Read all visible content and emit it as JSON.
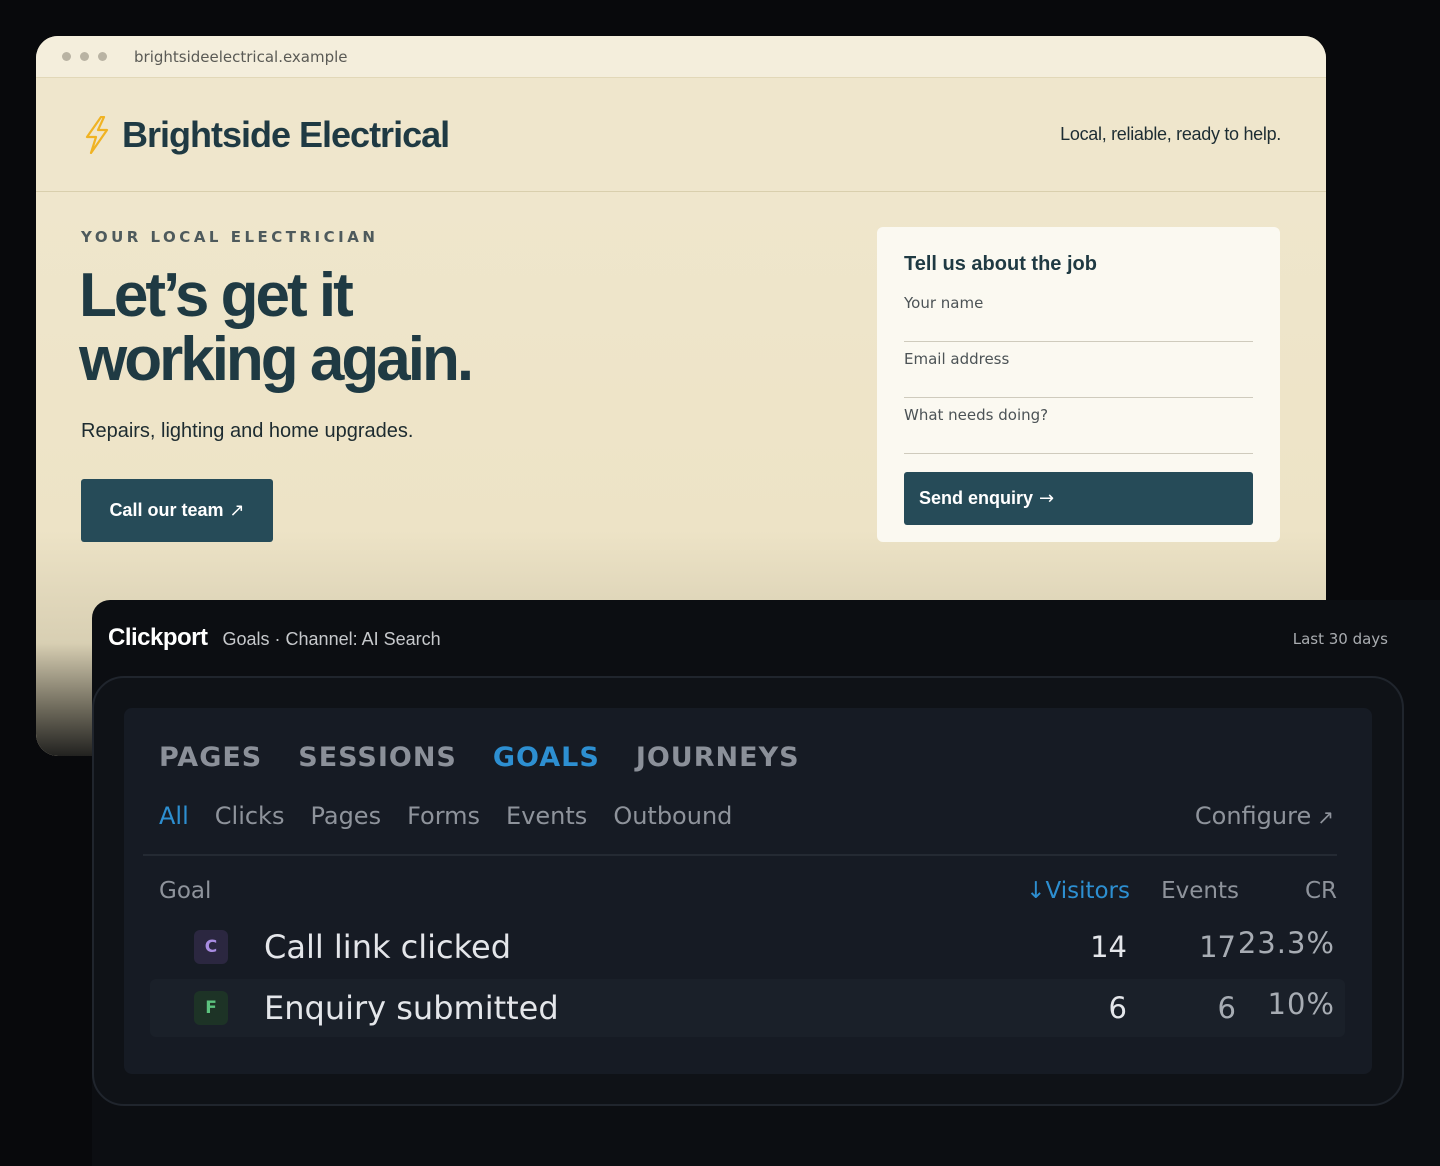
{
  "browser": {
    "url": "brightsideelectrical.example"
  },
  "site": {
    "brand": "Brightside Electrical",
    "tagline": "Local, reliable, ready to help.",
    "eyebrow": "YOUR LOCAL ELECTRICIAN",
    "hero_title_line1": "Let’s get it",
    "hero_title_line2": "working again.",
    "hero_sub": "Repairs, lighting and home upgrades.",
    "cta_label": "Call our team",
    "cta_arrow": "↗",
    "accent_color": "#264b58",
    "bolt_color": "#f0b323"
  },
  "form": {
    "title": "Tell us about the job",
    "name_placeholder": "Your name",
    "email_placeholder": "Email address",
    "job_placeholder": "What needs doing?",
    "submit_label": "Send enquiry",
    "submit_arrow": "→"
  },
  "analytics": {
    "logo": "Clickport",
    "breadcrumb": "Goals · Channel: AI Search",
    "range": "Last 30 days",
    "main_tabs": [
      "PAGES",
      "SESSIONS",
      "GOALS",
      "JOURNEYS"
    ],
    "active_main_tab": "GOALS",
    "sub_tabs": [
      "All",
      "Clicks",
      "Pages",
      "Forms",
      "Events",
      "Outbound"
    ],
    "active_sub_tab": "All",
    "configure_label": "Configure",
    "configure_arrow": "↗",
    "columns": {
      "goal": "Goal",
      "sort_arrow": "↓",
      "visitors": "Visitors",
      "events": "Events",
      "cr": "CR"
    },
    "rows": [
      {
        "badge": "C",
        "label": "Call link clicked",
        "visitors": "14",
        "events": "17",
        "cr": "23.3%"
      },
      {
        "badge": "F",
        "label": "Enquiry submitted",
        "visitors": "6",
        "events": "6",
        "cr": "10%"
      }
    ],
    "accent_color": "#2d8fd1"
  }
}
